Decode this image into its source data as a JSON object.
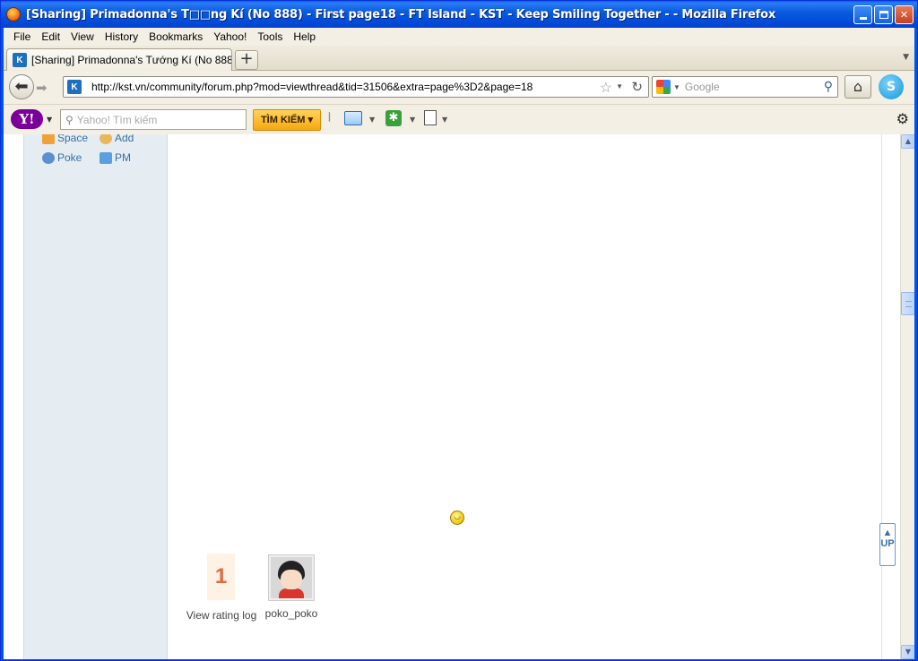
{
  "window": {
    "title": "[Sharing] Primadonna's T□□ng Kí (No 888) - First page18 - FT Island - KST - Keep Smiling Together - - Mozilla Firefox"
  },
  "menu": {
    "items": [
      "File",
      "Edit",
      "View",
      "History",
      "Bookmarks",
      "Yahoo!",
      "Tools",
      "Help"
    ]
  },
  "tabs": [
    {
      "label": "[Sharing] Primadonna's Tướng Kí (No 888) - ..."
    }
  ],
  "navigation": {
    "url": "http://kst.vn/community/forum.php?mod=viewthread&tid=31506&extra=page%3D2&page=18",
    "search_placeholder": "Google"
  },
  "yahoo_toolbar": {
    "search_placeholder": "Yahoo! Tìm kiếm",
    "search_button": "TÌM KIẾM"
  },
  "sidebar": {
    "links": [
      "Space",
      "Add",
      "Poke",
      "PM"
    ]
  },
  "rating": {
    "count": "1",
    "label": "View rating log",
    "users": [
      "poko_poko"
    ]
  },
  "floating": {
    "up_label": "UP"
  },
  "colors": {
    "titlebar": "#0a5be0",
    "sidebar_bg": "#e5edf2",
    "link": "#3a6fa5",
    "rating_number": "#e06b3f"
  }
}
